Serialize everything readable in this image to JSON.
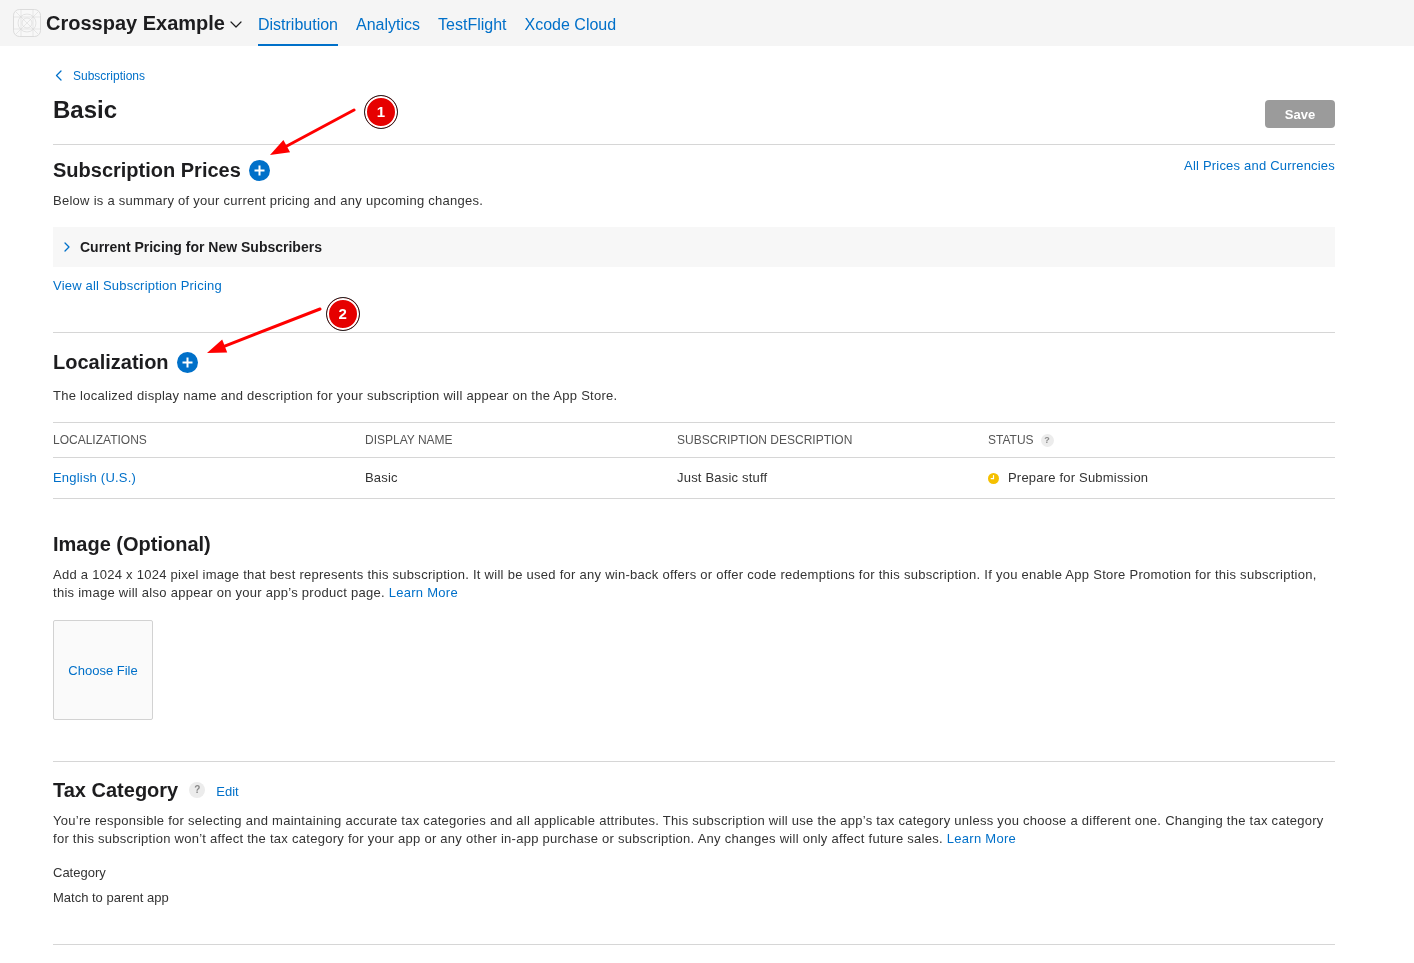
{
  "header": {
    "app_name": "Crosspay Example",
    "tabs": [
      {
        "label": "Distribution",
        "selected": true
      },
      {
        "label": "Analytics",
        "selected": false
      },
      {
        "label": "TestFlight",
        "selected": false
      },
      {
        "label": "Xcode Cloud",
        "selected": false
      }
    ]
  },
  "page": {
    "back_link": "Subscriptions",
    "title": "Basic",
    "save_button": {
      "label": "Save",
      "disabled": true
    }
  },
  "subscription_prices": {
    "title": "Subscription Prices",
    "annotation": "1",
    "side_link": "All Prices and Currencies",
    "description": "Below is a summary of your current pricing and any upcoming changes.",
    "disclosure": {
      "label": "Current Pricing for New Subscribers",
      "expanded": false
    },
    "view_all_link": "View all Subscription Pricing"
  },
  "localization": {
    "title": "Localization",
    "annotation": "2",
    "description": "The localized display name and description for your subscription will appear on the App Store.",
    "table": {
      "columns": [
        {
          "label": "LOCALIZATIONS"
        },
        {
          "label": "DISPLAY NAME"
        },
        {
          "label": "SUBSCRIPTION DESCRIPTION"
        },
        {
          "label": "STATUS",
          "help": "?"
        }
      ],
      "rows": [
        {
          "localization": "English (U.S.)",
          "display_name": "Basic",
          "description": "Just Basic stuff",
          "status": "Prepare for Submission",
          "color": "#f5c000"
        }
      ]
    }
  },
  "image": {
    "title": "Image (Optional)",
    "description": "Add a 1024 x 1024 pixel image that best represents this subscription. It will be used for any win-back offers or offer code redemptions for this subscription. If you enable App Store Promotion for this subscription, this image will also appear on your app’s product page.",
    "learn_more": "Learn More",
    "choose_file": "Choose File"
  },
  "tax_category": {
    "title": "Tax Category",
    "help": "?",
    "edit_link": "Edit",
    "description": "You’re responsible for selecting and maintaining accurate tax categories and all applicable attributes. This subscription will use the app’s tax category unless you choose a different one. Changing the tax category for this subscription won’t affect the tax category for your app or any other in-app purchase or subscription. Any changes will only affect future sales.",
    "learn_more": "Learn More",
    "category_label": "Category",
    "category_value": "Match to parent app"
  }
}
